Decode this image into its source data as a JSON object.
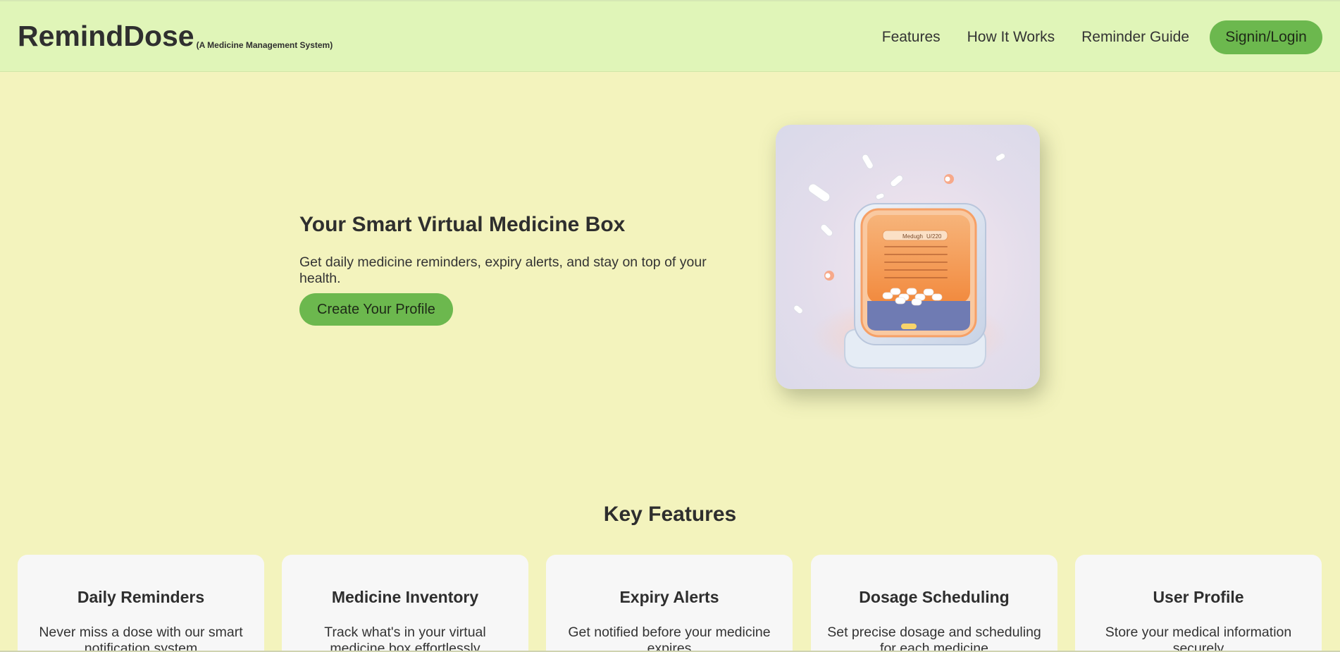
{
  "header": {
    "brand_name": "RemindDose",
    "brand_tagline": "(A Medicine Management System)",
    "nav": [
      "Features",
      "How It Works",
      "Reminder Guide"
    ],
    "signin_label": "Signin/Login"
  },
  "hero": {
    "title": "Your Smart Virtual Medicine Box",
    "subtitle": "Get daily medicine reminders, expiry alerts, and stay on top of your health.",
    "cta_label": "Create Your Profile",
    "image_label": "Medugh",
    "image_label2": "U/220"
  },
  "features": {
    "title": "Key Features",
    "cards": [
      {
        "title": "Daily Reminders",
        "desc": "Never miss a dose with our smart notification system"
      },
      {
        "title": "Medicine Inventory",
        "desc": "Track what's in your virtual medicine box effortlessly"
      },
      {
        "title": "Expiry Alerts",
        "desc": "Get notified before your medicine expires"
      },
      {
        "title": "Dosage Scheduling",
        "desc": "Set precise dosage and scheduling for each medicine"
      },
      {
        "title": "User Profile",
        "desc": "Store your medical information securely"
      }
    ]
  },
  "colors": {
    "page_bg": "#f3f3bd",
    "header_bg": "#e0f5b8",
    "accent_green": "#6cb84e",
    "card_bg": "#f7f7f7"
  }
}
